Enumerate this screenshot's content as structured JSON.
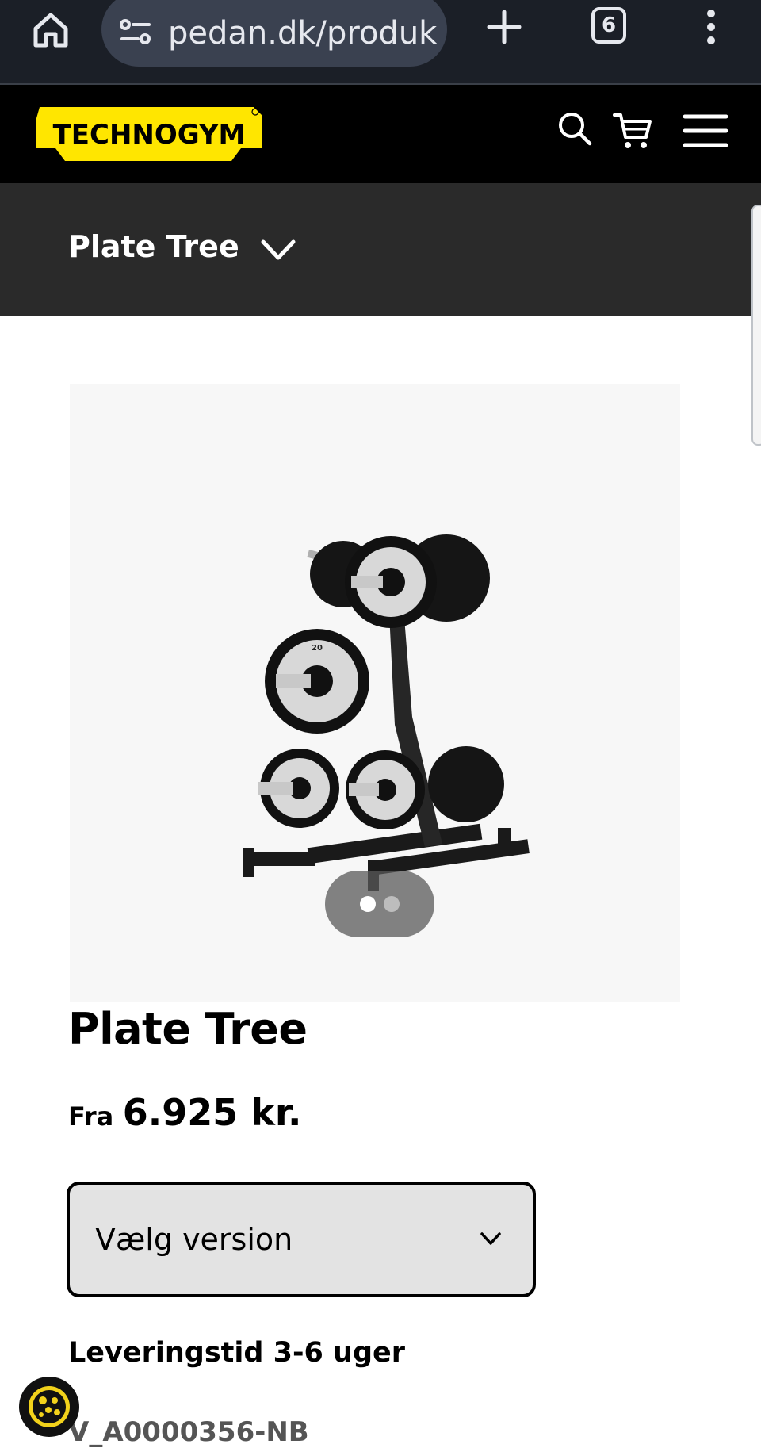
{
  "browser": {
    "url": "pedan.dk/produk",
    "tab_count": "6",
    "icons": [
      "home-icon",
      "site-settings-icon",
      "plus-icon",
      "tabs-icon",
      "kebab-menu-icon"
    ]
  },
  "site_header": {
    "logo_text": "TECHNOGYM",
    "logo_color": "#ffe600",
    "icons": [
      "search-icon",
      "cart-icon",
      "hamburger-menu-icon"
    ]
  },
  "sub_nav": {
    "title": "Plate Tree"
  },
  "gallery": {
    "slide_count": 2,
    "active_slide": 1
  },
  "product": {
    "title": "Plate Tree",
    "price_prefix": "Fra",
    "price": "6.925 kr.",
    "version_select_label": "Vælg version",
    "delivery": "Leveringstid 3-6 uger",
    "sku": "V_A0000356-NB"
  },
  "colors": {
    "browser_bar": "#1b1f27",
    "url_pill": "#3a4150",
    "header_bg": "#000000",
    "sub_nav_bg": "#2a2a2a",
    "select_bg": "#e3e3e3"
  }
}
